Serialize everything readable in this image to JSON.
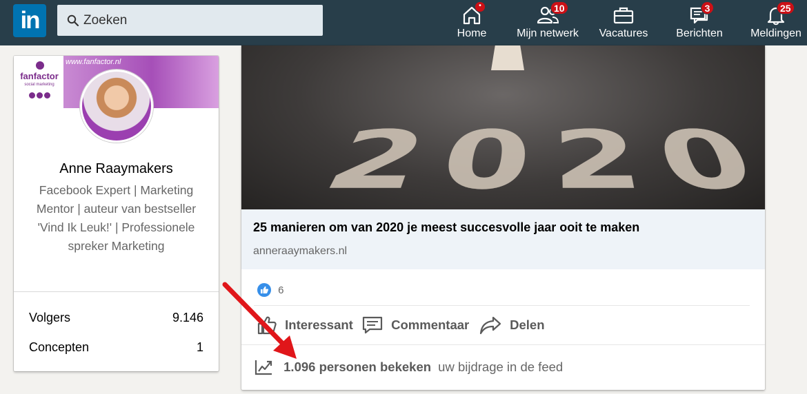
{
  "nav": {
    "logo": "in",
    "search": {
      "placeholder": "Zoeken"
    },
    "items": [
      {
        "label": "Home",
        "icon": "home-icon",
        "badge": ""
      },
      {
        "label": "Mijn netwerk",
        "icon": "network-icon",
        "badge": "10"
      },
      {
        "label": "Vacatures",
        "icon": "briefcase-icon",
        "badge": ""
      },
      {
        "label": "Berichten",
        "icon": "messaging-icon",
        "badge": "3"
      },
      {
        "label": "Meldingen",
        "icon": "bell-icon",
        "badge": "25"
      }
    ],
    "colors": {
      "background": "#283e4a",
      "badge": "#cc1016"
    }
  },
  "profile": {
    "banner_url": "www.fanfactor.nl",
    "banner_brand": "fanfactor",
    "banner_sub": "social marketing",
    "name": "Anne Raaymakers",
    "headline": "Facebook Expert | Marketing Mentor | auteur van bestseller 'Vind Ik Leuk!' | Professionele spreker Marketing",
    "stats": [
      {
        "label": "Volgers",
        "value": "9.146"
      },
      {
        "label": "Concepten",
        "value": "1"
      }
    ]
  },
  "post": {
    "image_text": "2020",
    "link_title": "25 manieren om van 2020 je meest succesvolle jaar ooit te maken",
    "link_source": "anneraaymakers.nl",
    "reaction_count": "6",
    "actions": [
      {
        "label": "Interessant",
        "icon": "like-icon"
      },
      {
        "label": "Commentaar",
        "icon": "comment-icon"
      },
      {
        "label": "Delen",
        "icon": "share-icon"
      }
    ],
    "views_bold": "1.096 personen bekeken",
    "views_rest": "uw bijdrage in de feed"
  }
}
